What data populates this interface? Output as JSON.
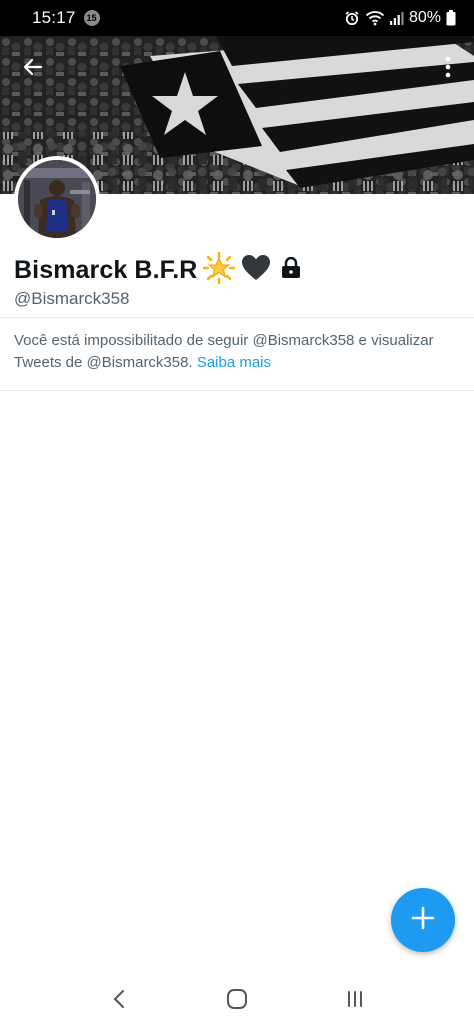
{
  "status_bar": {
    "time": "15:17",
    "notification_count": "15",
    "battery": "80%",
    "icons": [
      "alarm-icon",
      "wifi-icon",
      "signal-icon",
      "battery-icon"
    ]
  },
  "header": {
    "back_icon": "arrow-left-icon",
    "more_icon": "more-vertical-icon"
  },
  "profile": {
    "display_name": "Bismarck B.F.R",
    "name_emojis": [
      "🌟",
      "🖤"
    ],
    "protected_icon": "lock-icon",
    "handle": "@Bismarck358"
  },
  "protected_notice": {
    "text": "Você está impossibilitado de seguir @Bismarck358 e visualizar Tweets de @Bismarck358. ",
    "link": "Saiba mais"
  },
  "fab": {
    "icon": "plus-icon"
  },
  "nav": {
    "icons": [
      "back-chevron-icon",
      "home-circle-icon",
      "recents-icon"
    ]
  },
  "colors": {
    "accent": "#1d9bf0",
    "secondary_text": "#536471",
    "primary_text": "#0f1419"
  }
}
